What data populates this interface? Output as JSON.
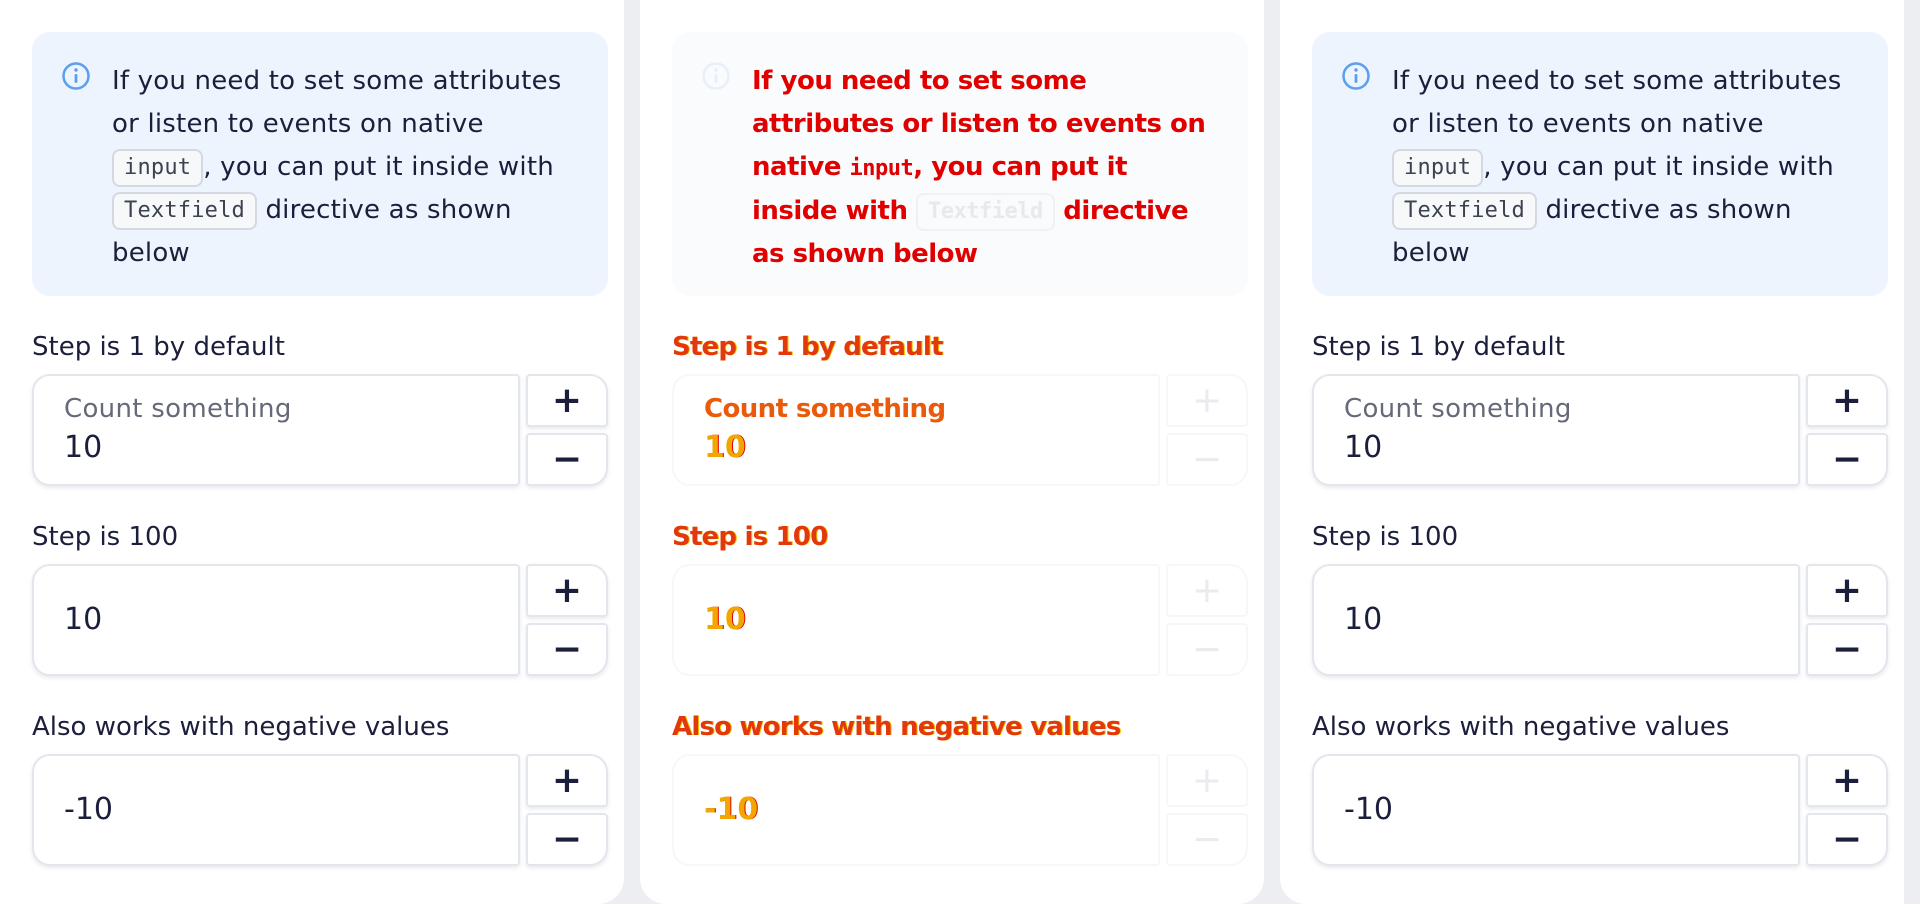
{
  "notice": {
    "text_before": "If you need to set some attributes or listen to events on native ",
    "code_input": "input",
    "text_middle": ", you can put it inside with ",
    "code_textfield": "Textfield",
    "text_after": " directive as shown below",
    "icon": "info-icon"
  },
  "fields": [
    {
      "label": "Step is 1 by default",
      "placeholder": "Count something",
      "value": "10",
      "plus_label": "+",
      "minus_label": "−"
    },
    {
      "label": "Step is 100",
      "value": "10",
      "plus_label": "+",
      "minus_label": "−"
    },
    {
      "label": "Also works with negative values",
      "value": "-10",
      "plus_label": "+",
      "minus_label": "−"
    }
  ],
  "colors": {
    "notice_bg": "#edf4fe",
    "info_icon": "#5b9ef0",
    "text": "#1b1f3b",
    "placeholder": "#646a78"
  }
}
